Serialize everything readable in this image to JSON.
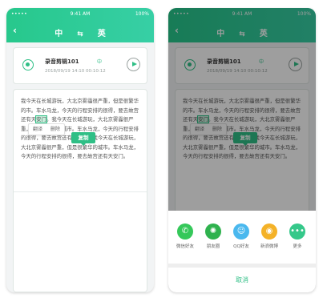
{
  "status_bar": {
    "signal": "•••••",
    "time": "9:41 AM",
    "battery": "100%"
  },
  "header": {
    "back_icon": "back-arrow-icon",
    "lang_from": "中",
    "swap_icon": "⇆",
    "lang_to": "英"
  },
  "audio": {
    "name": "录音剪辑101",
    "lang": "中",
    "meta": "2018/09/19 14:10 00:10:12"
  },
  "text": {
    "before_highlight": "我今天在长城游玩，大北京雾霾很严重，但是很繁华的市。车水马龙，今天的行程安排的很得，要去故宫还有天",
    "highlight": "安门",
    "after_highlight": "。我今天在长城游玩，大北京雾霾很严重，但是很繁华的城市。车水马龙，今天的行程安排的很得，要去故宫还有天安门。我今天在长城游玩，大北京雾霾很严重，但是很繁华的城市。车水马龙，今天的行程安排的很得，要去故宫还有天安门。"
  },
  "context_menu": {
    "translate": "翻译",
    "delete": "删除",
    "copy": "复制"
  },
  "share": {
    "items": [
      {
        "label": "微信好友",
        "icon": "wechat-icon",
        "color": "#35c85a"
      },
      {
        "label": "朋友圈",
        "icon": "moments-icon",
        "color": "#2fb24e"
      },
      {
        "label": "QQ好友",
        "icon": "qq-icon",
        "color": "#4ab8ee"
      },
      {
        "label": "新浪微博",
        "icon": "weibo-icon",
        "color": "#f4b228"
      },
      {
        "label": "更多",
        "icon": "more-icon",
        "color": "#35c88a"
      }
    ],
    "cancel": "取消"
  },
  "colors": {
    "accent": "#2fbf86",
    "header_start": "#27c88c",
    "header_end": "#37cfa5"
  }
}
